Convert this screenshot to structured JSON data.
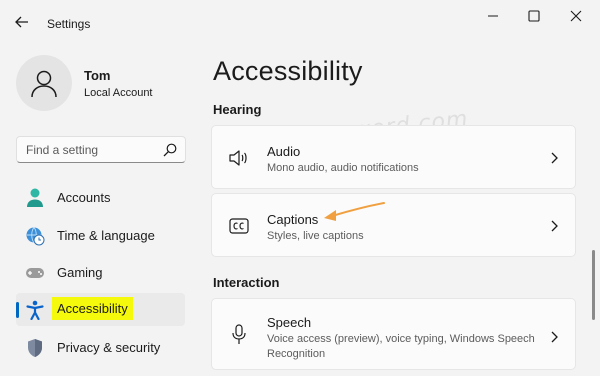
{
  "window": {
    "title": "Settings",
    "icons": {
      "back": "back-arrow-icon",
      "minimize": "minimize-icon",
      "maximize": "maximize-icon",
      "close": "close-icon"
    }
  },
  "user": {
    "name": "Tom",
    "account_type": "Local Account",
    "avatar_icon": "user-avatar-icon"
  },
  "search": {
    "placeholder": "Find a setting",
    "icon": "search-icon"
  },
  "sidebar": {
    "items": [
      {
        "label": "Accounts",
        "icon": "accounts-icon",
        "active": false
      },
      {
        "label": "Time & language",
        "icon": "globe-clock-icon",
        "active": false
      },
      {
        "label": "Gaming",
        "icon": "gamepad-icon",
        "active": false
      },
      {
        "label": "Accessibility",
        "icon": "accessibility-icon",
        "active": true
      },
      {
        "label": "Privacy & security",
        "icon": "shield-icon",
        "active": false
      }
    ]
  },
  "main": {
    "title": "Accessibility",
    "sections": [
      {
        "title": "Hearing",
        "cards": [
          {
            "title": "Audio",
            "subtitle": "Mono audio, audio notifications",
            "icon": "speaker-icon"
          },
          {
            "title": "Captions",
            "subtitle": "Styles, live captions",
            "icon": "captions-icon"
          }
        ]
      },
      {
        "title": "Interaction",
        "cards": [
          {
            "title": "Speech",
            "subtitle_line1": "Voice access (preview), voice typing, Windows Speech",
            "subtitle_line2": "Recognition",
            "icon": "microphone-icon"
          }
        ]
      }
    ]
  },
  "watermark": "top-password.com",
  "colors": {
    "accent": "#0067c0",
    "highlight": "#f5f90b",
    "annotation_arrow": "#f0a040",
    "background": "#f3f3f3",
    "card": "#fbfbfb"
  }
}
